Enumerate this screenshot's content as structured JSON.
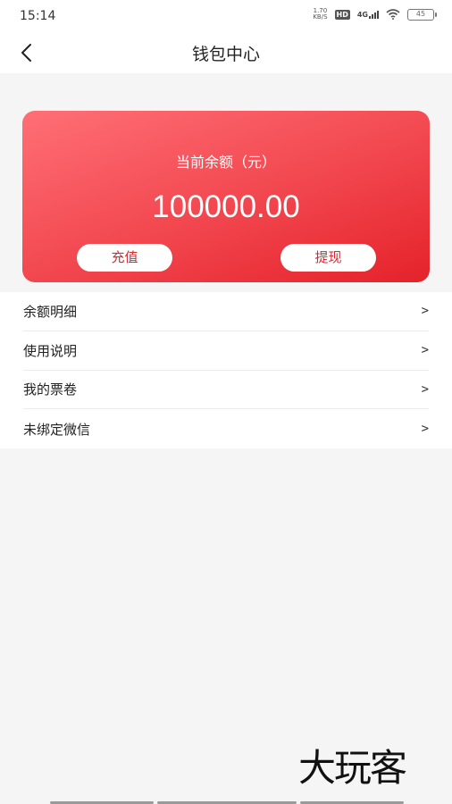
{
  "status_bar": {
    "time": "15:14",
    "net_speed_value": "1.70",
    "net_speed_unit": "KB/S",
    "hd": "HD",
    "network": "4G",
    "battery": "45"
  },
  "header": {
    "title": "钱包中心",
    "back_icon": "chevron-left-icon"
  },
  "wallet_card": {
    "balance_label": "当前余额（元）",
    "balance_amount": "100000.00",
    "recharge_label": "充值",
    "withdraw_label": "提现",
    "gradient_colors": [
      "#ff6f76",
      "#e5222a"
    ],
    "button_text_color": "#d62a31"
  },
  "menu": {
    "items": [
      {
        "label": "余额明细",
        "arrow": ">"
      },
      {
        "label": "使用说明",
        "arrow": ">"
      },
      {
        "label": "我的票卷",
        "arrow": ">"
      },
      {
        "label": "未绑定微信",
        "arrow": ">"
      }
    ]
  },
  "watermark": {
    "text": "大玩客"
  }
}
